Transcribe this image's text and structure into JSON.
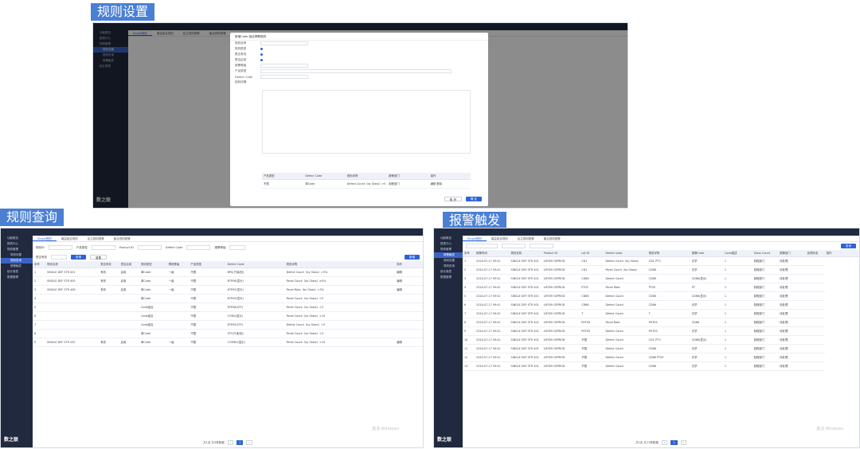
{
  "labels": {
    "settings": "规则设置",
    "query": "规则查询",
    "alarm": "报警触发"
  },
  "app": {
    "logo": "数之联",
    "sidebar": [
      "功能概览",
      "报表中心",
      "规则管理",
      "规则设置",
      "规则查询",
      "报警触发",
      "统计报表",
      "数据管理"
    ],
    "tabs": [
      "Single规则",
      "增益组合规则",
      "反主规则报警",
      "聚合规则报警"
    ]
  },
  "query_screen": {
    "filters": [
      "规则ID",
      "产品类型",
      "Product ID",
      "静压/阻值",
      "Defect Code",
      "报警等级",
      "是否有效",
      "是否启用"
    ],
    "search": "查询",
    "reset": "重置",
    "add": "新增",
    "headers": [
      "序号",
      "规则名称",
      "是否有效",
      "是否启用",
      "规则类型",
      "警报等级",
      "产品类型",
      "Defect Code",
      "规则详情",
      "操作"
    ],
    "rows": [
      [
        "1",
        "SINGLE DEF STR 401",
        "有效",
        "启用",
        "单Code",
        "一级",
        "不限",
        "BP0(只读/回)",
        "Defect Count（by Glass）>5%",
        "编辑"
      ],
      [
        "2",
        "SINGLE DEF STR 405",
        "有效",
        "启用",
        "单Code",
        "一级",
        "不限",
        "BTP06(显头)",
        "Panel Count（by Glass）≥5%",
        "编辑"
      ],
      [
        "3",
        "SINGLE DEF STR 406",
        "有效",
        "启用",
        "单Code",
        "一级",
        "不限",
        "BTP05(显头)",
        "Panel Rate（by Glass）>5%",
        "编辑"
      ],
      [
        "4",
        "",
        "",
        "",
        "单Code",
        "",
        "不限",
        "BTP05(显头)",
        "Panel Count（by Glass）>5",
        ""
      ],
      [
        "5",
        "",
        "",
        "",
        "Code组合",
        "",
        "不限",
        "BTP06(STF)",
        "Panel Count（by Glass）>3",
        ""
      ],
      [
        "6",
        "",
        "",
        "",
        "Code组合",
        "",
        "不限",
        "CORD(显示)",
        "Panel Count（by Glass）>10",
        ""
      ],
      [
        "7",
        "",
        "",
        "",
        "Code组合",
        "",
        "不限",
        "BTP05(STF)",
        "Defect Count（by Glass）>5",
        ""
      ],
      [
        "8",
        "",
        "",
        "",
        "单Code",
        "",
        "不限",
        "STF(只读/回)",
        "Panel Count（by Glass）>3",
        ""
      ],
      [
        "9",
        "SINGLE DEF STR 432",
        "有效",
        "启用",
        "单Code",
        "一级",
        "不限",
        "COMBO(显示)",
        "Panel Count（by Glass）>10",
        "编辑"
      ]
    ],
    "pager": "共1页 共9条数据",
    "page": "1"
  },
  "alarm_screen": {
    "headers": [
      "序号",
      "报警时间",
      "规则名称",
      "Product ID",
      "Lot ID",
      "Defect Code",
      "规则详情",
      "报警Code",
      "Code描述",
      "Glass Count",
      "报警部门",
      "处理状态",
      "操作"
    ],
    "rows": [
      [
        "1",
        "2024-07-17 09:41",
        "SINGLE DEF STR 401",
        "LM789 GEPROD",
        "CD1",
        "Defect Count（by Glass）",
        "CD1 PTO",
        "光学",
        "1",
        "制程部门",
        "待处理"
      ],
      [
        "2",
        "2024-07-17 09:41",
        "SINGLE DEF STR 401",
        "LM789 GEPROD",
        "CD1",
        "Panel Count（by Glass）",
        "CD66",
        "光学",
        "1",
        "制程部门",
        "待处理"
      ],
      [
        "3",
        "2024-07-17 09:41",
        "SINGLE DEF STR 401",
        "LM789 GEPROD",
        "CD66",
        "Defect Count",
        "CD66",
        "CD66(显示)",
        "1",
        "制程部门",
        "待处理"
      ],
      [
        "4",
        "2024-07-17 09:41",
        "SINGLE DEF STR 401",
        "LM789 GEPROD",
        "PT05",
        "Panel Rate",
        "PT05",
        "PT",
        "1",
        "制程部门",
        "待处理"
      ],
      [
        "5",
        "2024-07-17 09:41",
        "SINGLE DEF STR 401",
        "LM789 GEPROD",
        "CD66",
        "Defect Count",
        "CD66",
        "CD66(显示)",
        "1",
        "制程部门",
        "待处理"
      ],
      [
        "6",
        "2024-07-17 09:41",
        "SINGLE DEF STR 401",
        "LM789 GEPROD",
        "CD66",
        "Defect Count",
        "CD66",
        "光学",
        "1",
        "制程部门",
        "待处理"
      ],
      [
        "7",
        "2024-07-17 09:41",
        "SINGLE DEF STR 401",
        "LM789 GEPROD",
        "T",
        "Defect Count",
        "T",
        "光学",
        "1",
        "制程部门",
        "待处理"
      ],
      [
        "8",
        "2024-07-17 09:41",
        "SINGLE DEF STR 401",
        "LM789 GEPROD",
        "PHT05",
        "Panel Rate",
        "PHT05",
        "CD66",
        "1",
        "制程部门",
        "待处理"
      ],
      [
        "9",
        "2024-07-17 09:41",
        "SINGLE DEF STR 401",
        "LM789 GEPROD",
        "PHT05",
        "Defect Count",
        "PHT05",
        "光学",
        "1",
        "制程部门",
        "待处理"
      ],
      [
        "10",
        "2024-07-17 09:41",
        "SINGLE DEF STR 401",
        "LM789 GEPROD",
        "不限",
        "Defect Count",
        "CD1 PTO",
        "CD66(显示)",
        "1",
        "制程部门",
        "待处理"
      ],
      [
        "11",
        "2024-07-17 09:41",
        "SINGLE DEF STR 401",
        "LM789 GEPROD",
        "不限",
        "Defect Count",
        "CD66",
        "光学",
        "1",
        "制程部门",
        "待处理"
      ],
      [
        "12",
        "2024-07-17 09:41",
        "SINGLE DEF STR 401",
        "LM789 GEPROD",
        "不限",
        "Defect Count",
        "CD66 PT05",
        "光学",
        "1",
        "制程部门",
        "待处理"
      ],
      [
        "13",
        "2024-07-17 09:41",
        "SINGLE DEF STR 401",
        "LM789 GEPROD",
        "不限",
        "Defect Count",
        "CD66",
        "光学",
        "1",
        "制程部门",
        "待处理"
      ]
    ],
    "pager": "共1页 共13条数据",
    "page": "1"
  },
  "settings_screen": {
    "modal_title": "新增Code 组合预警规则",
    "fields": [
      "规则名称",
      "规则类型",
      "是否有效",
      "是否启用",
      "报警等级",
      "产品类型",
      "Defect Code",
      "规则详情"
    ],
    "cancel": "取 消",
    "confirm": "确 定",
    "table_headers": [
      "产品类型",
      "Defect Code",
      "规则详情",
      "报警部门",
      "操作"
    ],
    "table_row": [
      "不限",
      "单Code",
      "Defect Count（by Glass）>5",
      "制程部门",
      "编辑  删除"
    ]
  },
  "watermark": "激活 Windows"
}
